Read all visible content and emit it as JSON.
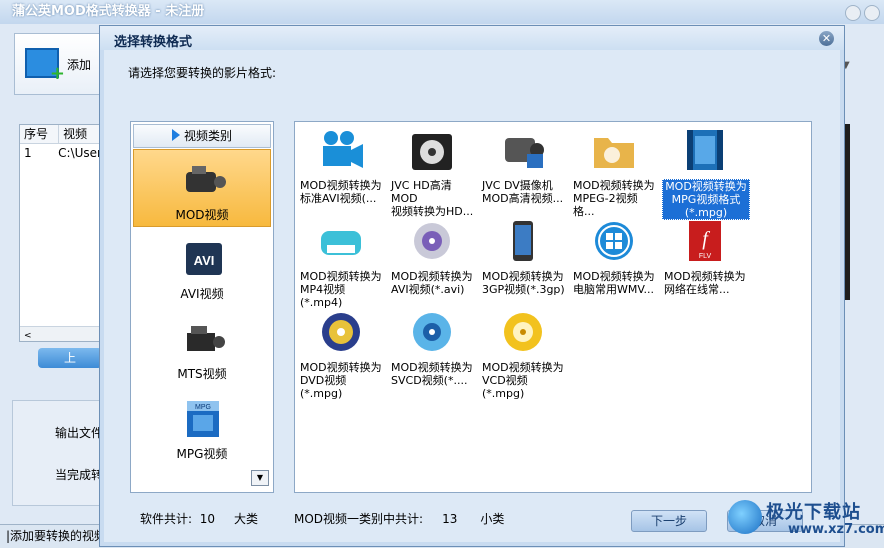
{
  "app": {
    "title": "蒲公英MOD格式转换器 - 未注册",
    "toolbar_add": "添加",
    "list_headers": [
      "序号",
      "视频"
    ],
    "list_row": [
      "1",
      "C:\\User"
    ],
    "up_button": "上",
    "labels": [
      "输出文件",
      "当完成转"
    ],
    "status": "|添加要转换的视频",
    "watermark_brand": "极光下载站",
    "watermark_url": "www.xz7.com"
  },
  "dialog": {
    "title": "选择转换格式",
    "prompt": "请选择您要转换的影片格式:",
    "category_header": "视频类别",
    "categories": [
      {
        "label": "MOD视频",
        "icon": "camcorder-icon",
        "selected": true
      },
      {
        "label": "AVI视频",
        "icon": "avi-icon",
        "selected": false
      },
      {
        "label": "MTS视频",
        "icon": "pro-camera-icon",
        "selected": false
      },
      {
        "label": "MPG视频",
        "icon": "mpg-file-icon",
        "selected": false
      }
    ],
    "formats": [
      {
        "label": "MOD视频转换为\n标准AVI视频(...",
        "icon": "video-camera-icon"
      },
      {
        "label": "JVC HD高清MOD\n视频转换为HD...",
        "icon": "film-reel-icon"
      },
      {
        "label": "JVC DV摄像机\nMOD高清视频...",
        "icon": "dv-camcorder-icon"
      },
      {
        "label": "MOD视频转换为\nMPEG-2视频格...",
        "icon": "folder-film-icon"
      },
      {
        "label": "MOD视频转换为\nMPG视频格式\n(*.mpg)",
        "icon": "film-strip-icon",
        "selected": true
      },
      {
        "label": "MOD视频转换为\nMP4视频(*.mp4)",
        "icon": "usb-drive-icon"
      },
      {
        "label": "MOD视频转换为\nAVI视频(*.avi)",
        "icon": "disc-icon"
      },
      {
        "label": "MOD视频转换为\n3GP视频(*.3gp)",
        "icon": "phone-icon"
      },
      {
        "label": "MOD视频转换为\n电脑常用WMV...",
        "icon": "windows-icon"
      },
      {
        "label": "MOD视频转换为\n网络在线常...",
        "icon": "flash-flv-icon"
      },
      {
        "label": "MOD视频转换为\nDVD视频(*.mpg)",
        "icon": "dvd-icon"
      },
      {
        "label": "MOD视频转换为\nSVCD视频(*....",
        "icon": "svcd-disc-icon"
      },
      {
        "label": "MOD视频转换为\nVCD视频(*.mpg)",
        "icon": "vcd-disc-icon"
      }
    ],
    "counts": {
      "software_label": "软件共计:",
      "software_num": "10",
      "software_unit": "大类",
      "category_label": "MOD视频一类别中共计:",
      "category_num": "13",
      "category_unit": "小类"
    },
    "buttons": {
      "next": "下一步",
      "cancel": "取消"
    }
  }
}
